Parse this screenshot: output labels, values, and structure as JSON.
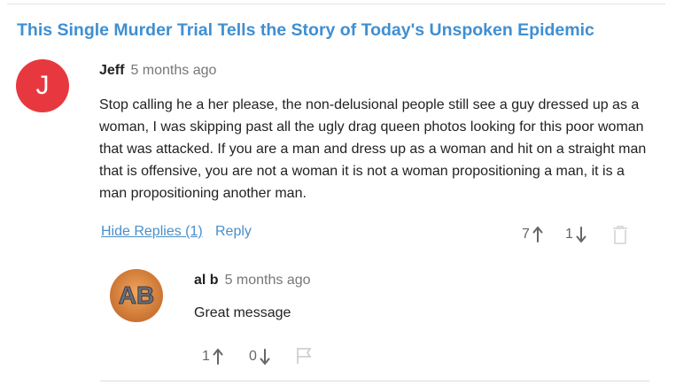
{
  "article": {
    "title": "This Single Murder Trial Tells the Story of Today's Unspoken Epidemic"
  },
  "comment": {
    "avatar_letter": "J",
    "avatar_color": "#e8383f",
    "author": "Jeff",
    "time": "5 months ago",
    "text": "Stop calling he a her please, the non-delusional people still see a guy dressed up as a woman, I was skipping past all the ugly drag queen photos looking for this poor woman that was attacked. If you are a man and dress up as a woman and hit on a straight man that is offensive, you are not a woman it is not a woman propositioning a man, it is a man propositioning another man.",
    "actions": {
      "hide_replies": "Hide Replies (1)",
      "reply": "Reply"
    },
    "upvotes": "7",
    "downvotes": "1",
    "icons": {
      "up": "arrow-up-icon",
      "down": "arrow-down-icon",
      "delete": "trash-icon"
    }
  },
  "reply": {
    "avatar_initials": "AB",
    "author": "al b",
    "time": "5 months ago",
    "text": "Great message",
    "upvotes": "1",
    "downvotes": "0",
    "icons": {
      "up": "arrow-up-icon",
      "down": "arrow-down-icon",
      "flag": "flag-icon"
    }
  },
  "colors": {
    "title": "#3f8fd2",
    "link": "#4a8fc8",
    "muted": "#777777"
  }
}
